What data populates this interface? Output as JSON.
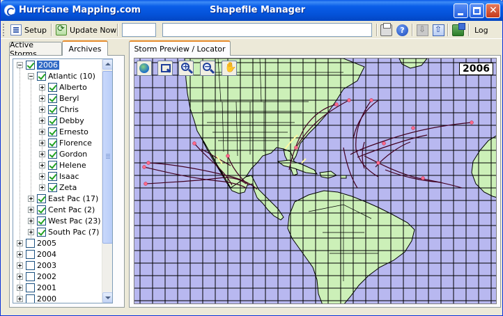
{
  "window": {
    "app_title": "Hurricane Mapping.com",
    "center_title": "Shapefile  Manager",
    "close_glyph": "✕"
  },
  "toolbar": {
    "setup_label": "Setup",
    "update_label": "Update Now",
    "field1_value": "",
    "field2_value": "",
    "help_glyph": "?",
    "log_label": "Log"
  },
  "left_tabs": [
    {
      "label": "Active Storms",
      "active": false
    },
    {
      "label": "Archives",
      "active": true
    }
  ],
  "tree": {
    "years_expanded": {
      "label": "2006",
      "checked": true,
      "selected": true
    },
    "atlantic": {
      "label": "Atlantic (10)",
      "checked": true
    },
    "storms": [
      "Alberto",
      "Beryl",
      "Chris",
      "Debby",
      "Ernesto",
      "Florence",
      "Gordon",
      "Helene",
      "Isaac",
      "Zeta"
    ],
    "basins": [
      {
        "label": "East Pac (17)",
        "checked": true
      },
      {
        "label": "Cent Pac (2)",
        "checked": true
      },
      {
        "label": "West Pac (23)",
        "checked": true
      },
      {
        "label": "South Pac (7)",
        "checked": true
      }
    ],
    "other_years": [
      "2005",
      "2004",
      "2003",
      "2002",
      "2001",
      "2000"
    ]
  },
  "right_tab": {
    "label": "Storm Preview / Locator"
  },
  "map": {
    "year_label": "2006",
    "tools": [
      "globe-icon",
      "zoom-rect-icon",
      "zoom-in-icon",
      "zoom-out-icon",
      "pan-hand-icon"
    ],
    "zoom_in_glyph": "+",
    "zoom_out_glyph": "−",
    "colors": {
      "ocean": "#b8b8f0",
      "land": "#ccf0b8",
      "grid": "#000000",
      "track": "#400020",
      "marker": "#ff6a8a"
    }
  }
}
